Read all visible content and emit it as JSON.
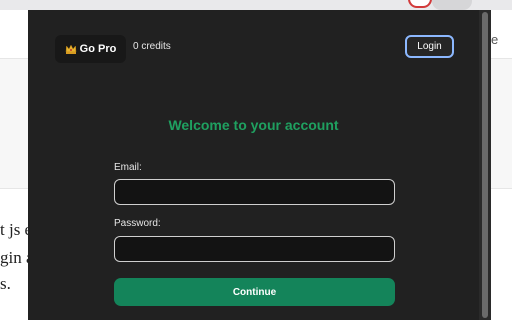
{
  "popup": {
    "go_pro_label": "Go Pro",
    "credits_text": "0 credits",
    "login_label": "Login",
    "welcome_heading": "Welcome to your account",
    "email_label": "Email:",
    "email_value": "",
    "password_label": "Password:",
    "password_value": "",
    "continue_label": "Continue"
  },
  "background_page": {
    "right_edge_text": "e",
    "left_text_lines": [
      "t js e",
      "gin a",
      "s."
    ]
  },
  "colors": {
    "popup_bg": "#212121",
    "accent_green": "#1fa060",
    "button_green": "#14845a",
    "login_border": "#8cb8ff"
  },
  "icons": {
    "go_pro": "crown-icon"
  }
}
